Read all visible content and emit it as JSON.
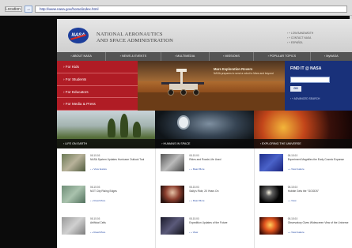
{
  "browser": {
    "address_label": "Location",
    "go_glyph": "→",
    "url": "http://www.nasa.gov/home/index.html"
  },
  "header": {
    "logo_text": "NASA",
    "agency_line1": "NATIONAL AERONAUTICS",
    "agency_line2": "AND SPACE ADMINISTRATION",
    "links": [
      "› + LOW BANDWIDTH",
      "› + CONTACT NASA",
      "› + ESPAÑOL"
    ]
  },
  "nav": [
    "› ABOUT NASA",
    "› NEWS & EVENTS",
    "› MULTIMEDIA",
    "› MISSIONS",
    "› POPULAR TOPICS",
    "› MyNASA"
  ],
  "audience": [
    "› For Kids",
    "› For Students",
    "› For Educators",
    "› For Media & Press"
  ],
  "feature": {
    "title": "Mars Exploration Rovers",
    "body": "NASA prepares to send a robot to Mars and beyond"
  },
  "find": {
    "title": "FIND IT @ NASA",
    "go_label": "GO",
    "advanced": "› + ADVANCED SEARCH"
  },
  "strips": [
    "› LIFE ON EARTH",
    "› HUMANS IN SPACE",
    "› EXPLORING THE UNIVERSE"
  ],
  "columns": [
    [
      {
        "label": "08.15.03",
        "title": "NASA System Updates Hurricane Outlook Tool",
        "more": "› + View feature"
      },
      {
        "label": "08.15.03",
        "title": "NOT City Rising Edges",
        "more": "› + Read More"
      },
      {
        "label": "08.15.03",
        "title": "Artificial Cells",
        "more": "› + Read More"
      }
    ],
    [
      {
        "label": "08.15.03",
        "title": "Rides and Roads Life Used",
        "more": "› + Read More"
      },
      {
        "label": "08.15.03",
        "title": "Sally's Ride, 20 Years On",
        "more": "› + Read More"
      },
      {
        "label": "08.15.03",
        "title": "Expedition Updates of the Future",
        "more": "› + View"
      }
    ],
    [
      {
        "label": "08.15.03",
        "title": "Experiment Magnifies the Early Cosmic Expanse",
        "more": "› + View feature"
      },
      {
        "label": "08.15.03",
        "title": "Hubble Gets the \"GOODS\"",
        "more": "› + View"
      },
      {
        "label": "08.15.03",
        "title": "Observatory Gives Widescreen View of the Universe",
        "more": "› + View feature"
      }
    ]
  ],
  "colors": {
    "nav_bar": "#545454",
    "audience_red": "#b01c25",
    "find_blue": "#19317a",
    "logo_blue": "#1d3e9b"
  }
}
